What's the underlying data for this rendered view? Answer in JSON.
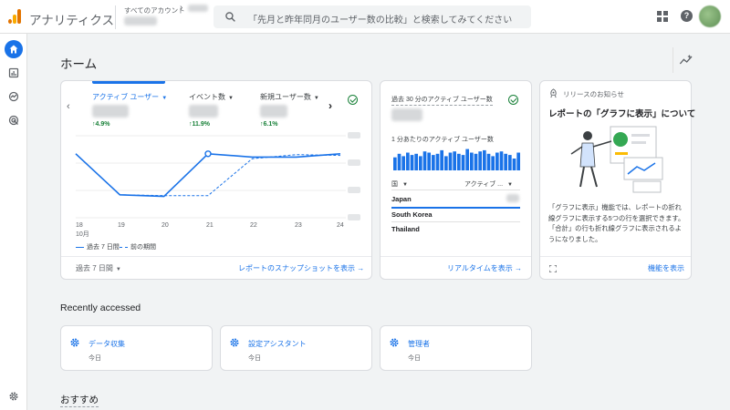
{
  "header": {
    "app_title": "アナリティクス",
    "account_label": "すべてのアカウント",
    "search_placeholder": "「先月と昨年同月のユーザー数の比較」と検索してみてください"
  },
  "page": {
    "title": "ホーム"
  },
  "overview_card": {
    "metrics": [
      {
        "label": "アクティブ ユーザー",
        "delta": "4.9%",
        "active": true
      },
      {
        "label": "イベント数",
        "delta": "11.9%",
        "active": false
      },
      {
        "label": "新規ユーザー数",
        "delta": "6.1%",
        "active": false
      }
    ],
    "x_ticks": [
      "18",
      "19",
      "20",
      "21",
      "22",
      "23",
      "24"
    ],
    "x_month": "10月",
    "legend_current": "過去 7 日間",
    "legend_previous": "前の期間",
    "date_range": "過去 7 日間",
    "snapshot_link": "レポートのスナップショットを表示"
  },
  "chart_data": {
    "type": "line",
    "categories": [
      "18",
      "19",
      "20",
      "21",
      "22",
      "23",
      "24"
    ],
    "series": [
      {
        "name": "過去 7 日間",
        "values": [
          0.78,
          0.28,
          0.26,
          0.78,
          0.74,
          0.74,
          0.78
        ]
      },
      {
        "name": "前の期間",
        "values": [
          0.78,
          0.28,
          0.27,
          0.27,
          0.72,
          0.77,
          0.76
        ]
      }
    ],
    "ylim": [
      0,
      1
    ],
    "grid": true
  },
  "realtime_card": {
    "title": "過去 30 分のアクティブ ユーザー数",
    "per_minute_label": "1 分あたりのアクティブ ユーザー数",
    "bar_heights": [
      0.55,
      0.7,
      0.6,
      0.75,
      0.65,
      0.7,
      0.6,
      0.8,
      0.75,
      0.65,
      0.7,
      0.85,
      0.6,
      0.75,
      0.8,
      0.7,
      0.65,
      0.9,
      0.75,
      0.7,
      0.8,
      0.85,
      0.7,
      0.6,
      0.75,
      0.8,
      0.7,
      0.65,
      0.5,
      0.75
    ],
    "col_country": "国",
    "col_users": "アクティブ ...",
    "rows": [
      "Japan",
      "South Korea",
      "Thailand"
    ],
    "realtime_link": "リアルタイムを表示"
  },
  "news_card": {
    "label": "リリースのお知らせ",
    "title": "レポートの「グラフに表示」について",
    "body": "「グラフに表示」機能では、レポートの折れ線グラフに表示する5つの行を選択できます。「合計」の行も折れ線グラフに表示されるようになりました。",
    "link": "機能を表示"
  },
  "recently_accessed": {
    "title": "Recently accessed",
    "items": [
      {
        "title": "データ収集",
        "sub": "今日"
      },
      {
        "title": "設定アシスタント",
        "sub": "今日"
      },
      {
        "title": "管理者",
        "sub": "今日"
      }
    ]
  },
  "recommended": {
    "title": "おすすめ"
  },
  "colors": {
    "accent": "#1a73e8",
    "positive": "#188038",
    "logo_orange": "#f9ab00",
    "logo_dark": "#e37400"
  }
}
